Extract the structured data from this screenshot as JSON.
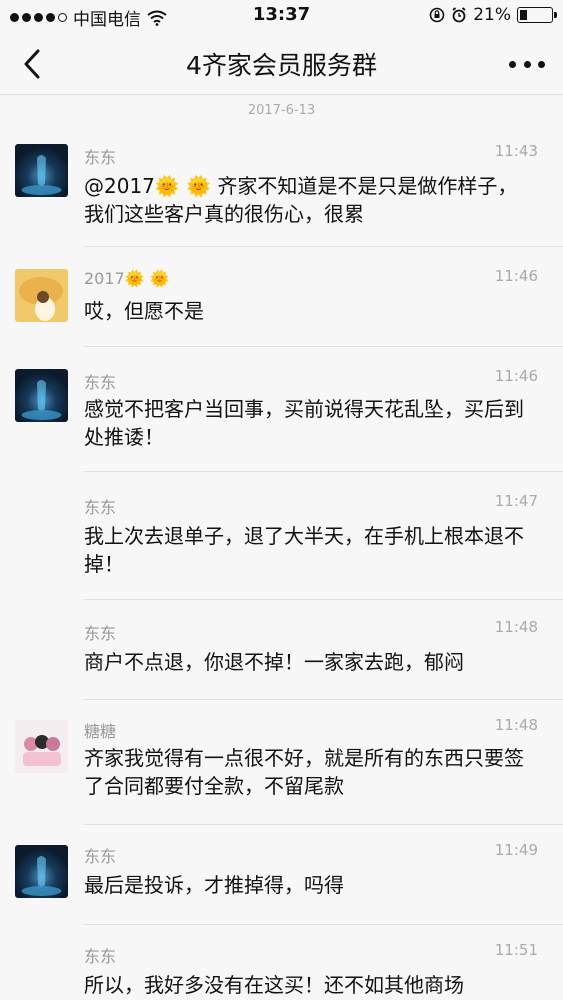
{
  "status": {
    "carrier": "中国电信",
    "time": "13:37",
    "battery": "21%"
  },
  "nav": {
    "title": "4齐家会员服务群"
  },
  "date_separator": "2017-6-13",
  "messages": [
    {
      "sender": "东东",
      "time": "11:43",
      "text": "@2017🌞 🌞 齐家不知道是不是只是做作样子，我们这些客户真的很伤心，很累"
    },
    {
      "sender": "2017🌞 🌞",
      "time": "11:46",
      "text": "哎，但愿不是"
    },
    {
      "sender": "东东",
      "time": "11:46",
      "text": "感觉不把客户当回事，买前说得天花乱坠，买后到处推诿！"
    },
    {
      "sender": "东东",
      "time": "11:47",
      "text": "我上次去退单子，退了大半天，在手机上根本退不掉！"
    },
    {
      "sender": "东东",
      "time": "11:48",
      "text": "商户不点退，你退不掉！一家家去跑，郁闷"
    },
    {
      "sender": "糖糖",
      "time": "11:48",
      "text": "齐家我觉得有一点很不好，就是所有的东西只要签了合同都要付全款，不留尾款"
    },
    {
      "sender": "东东",
      "time": "11:49",
      "text": "最后是投诉，才推掉得，吗得"
    },
    {
      "sender": "东东",
      "time": "11:51",
      "text": "所以，我好多没有在这买！还不如其他商场"
    }
  ]
}
